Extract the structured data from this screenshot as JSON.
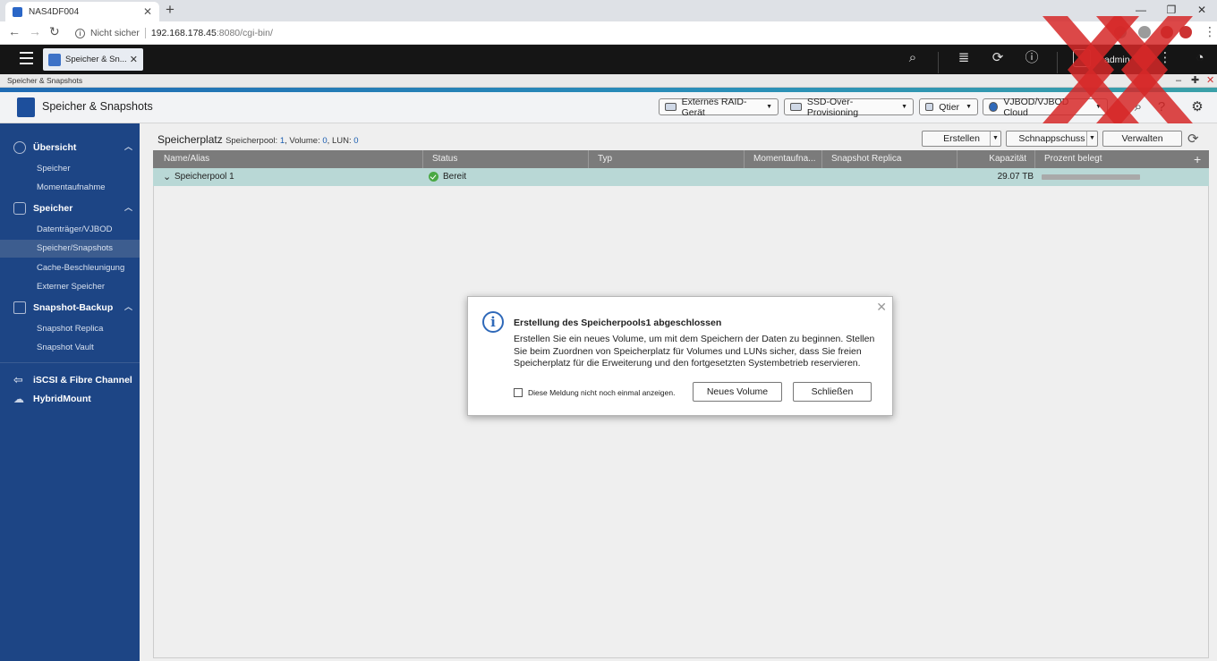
{
  "browser": {
    "tab_title": "NAS4DF004",
    "insecure_label": "Nicht sicher",
    "url_host": "192.168.178.45",
    "url_path": ":8080/cgi-bin/"
  },
  "qts": {
    "app_tab_label": "Speicher & Sn...",
    "username": "admin",
    "window_title": "Speicher & Snapshots"
  },
  "app": {
    "title": "Speicher & Snapshots",
    "toolbar": [
      {
        "label": "Externes RAID-Gerät"
      },
      {
        "label": "SSD-Over-Provisioning"
      },
      {
        "label": "Qtier"
      },
      {
        "label": "VJBOD/VJBOD Cloud"
      }
    ]
  },
  "sidebar": {
    "groups": [
      {
        "label": "Übersicht",
        "items": [
          "Speicher",
          "Momentaufnahme"
        ]
      },
      {
        "label": "Speicher",
        "items": [
          "Datenträger/VJBOD",
          "Speicher/Snapshots",
          "Cache-Beschleunigung",
          "Externer Speicher"
        ]
      },
      {
        "label": "Snapshot-Backup",
        "items": [
          "Snapshot Replica",
          "Snapshot Vault"
        ]
      },
      {
        "label": "iSCSI & Fibre Channel",
        "items": []
      },
      {
        "label": "HybridMount",
        "items": []
      }
    ],
    "active_item": "Speicher/Snapshots"
  },
  "main": {
    "title": "Speicherplatz",
    "sub_pool_label": "Speicherpool:",
    "sub_pool_count": "1",
    "sub_volume_label": "Volume:",
    "sub_volume_count": "0",
    "sub_lun_label": "LUN:",
    "sub_lun_count": "0",
    "buttons": {
      "create": "Erstellen",
      "snapshot": "Schnappschuss",
      "manage": "Verwalten"
    },
    "columns": [
      "Name/Alias",
      "Status",
      "Typ",
      "Momentaufna...",
      "Snapshot Replica",
      "Kapazität",
      "Prozent belegt"
    ],
    "rows": [
      {
        "name": "Speicherpool 1",
        "status": "Bereit",
        "type": "",
        "snapshot": "",
        "replica": "",
        "capacity": "29.07 TB",
        "used_fraction": 0
      }
    ]
  },
  "modal": {
    "title": "Erstellung des Speicherpools1 abgeschlossen",
    "body": "Erstellen Sie ein neues Volume, um mit dem Speichern der Daten zu beginnen. Stellen Sie beim Zuordnen von Speicherplatz für Volumes und LUNs sicher, dass Sie freien Speicherplatz für die Erweiterung und den fortgesetzten Systembetrieb reservieren.",
    "checkbox_label": "Diese Meldung nicht noch einmal anzeigen.",
    "btn_new_volume": "Neues Volume",
    "btn_close": "Schließen"
  },
  "colors": {
    "sidebar": "#1d4585",
    "row_selected": "#b9d8d6",
    "status_ok": "#4aa844",
    "accent": "#2f69b9"
  }
}
